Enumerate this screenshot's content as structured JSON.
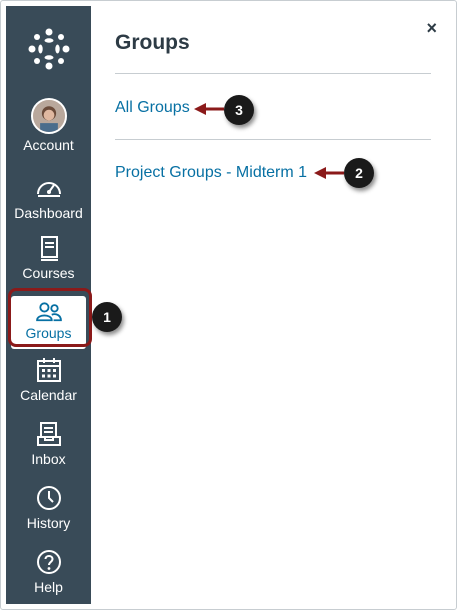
{
  "colors": {
    "sidebar_bg": "#394b58",
    "active_bg": "#ffffff",
    "link": "#0770a3",
    "highlight_border": "#8b1a1a",
    "callout_bg": "#1a1a1a",
    "arrow": "#8b1a1a"
  },
  "sidebar": {
    "logo_icon": "canvas-logo-icon",
    "items": [
      {
        "label": "Account",
        "icon": "avatar"
      },
      {
        "label": "Dashboard",
        "icon": "dashboard-gauge-icon"
      },
      {
        "label": "Courses",
        "icon": "book-icon"
      },
      {
        "label": "Groups",
        "icon": "people-icon",
        "active": true
      },
      {
        "label": "Calendar",
        "icon": "calendar-icon"
      },
      {
        "label": "Inbox",
        "icon": "inbox-icon"
      },
      {
        "label": "History",
        "icon": "clock-icon"
      },
      {
        "label": "Help",
        "icon": "question-circle-icon"
      }
    ]
  },
  "tray": {
    "title": "Groups",
    "close_icon": "close-icon",
    "close_label": "×",
    "links": [
      {
        "label": "All Groups"
      },
      {
        "label": "Project Groups - Midterm 1"
      }
    ]
  },
  "callouts": [
    "1",
    "2",
    "3"
  ]
}
